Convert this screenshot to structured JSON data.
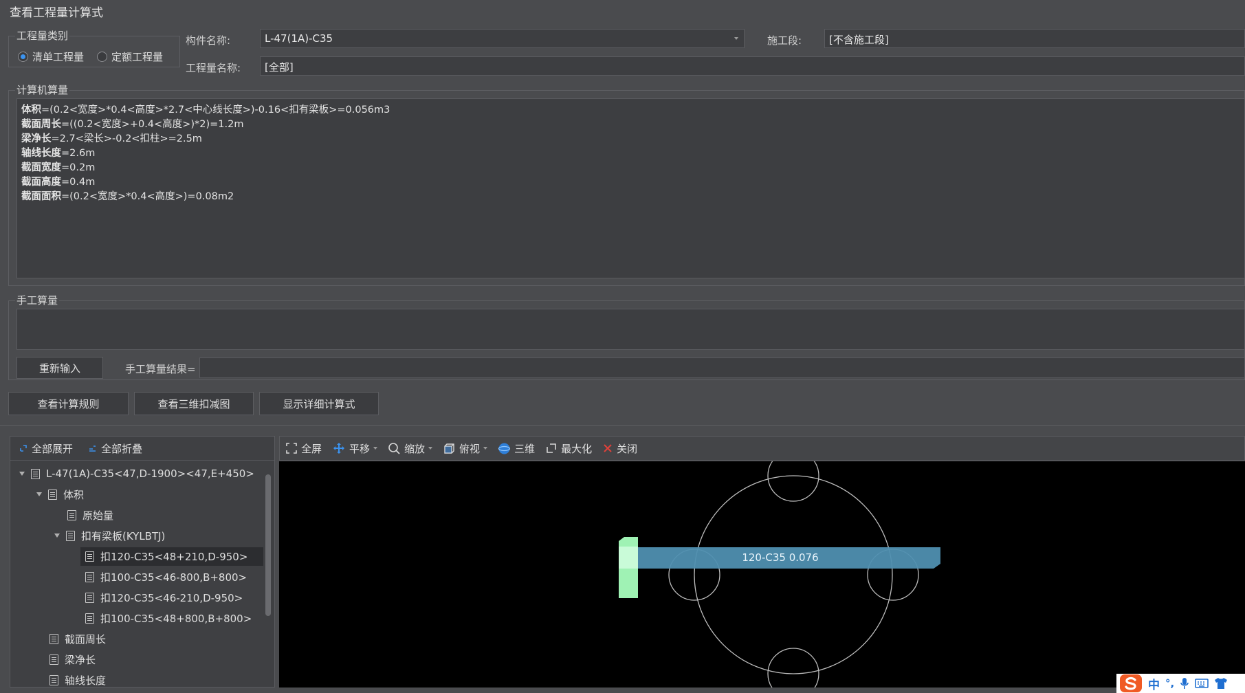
{
  "window": {
    "title": "查看工程量计算式"
  },
  "quantity_type": {
    "legend": "工程量类别",
    "options": [
      {
        "label": "清单工程量",
        "selected": true
      },
      {
        "label": "定额工程量",
        "selected": false
      }
    ]
  },
  "component": {
    "label": "构件名称:",
    "value": "L-47(1A)-C35"
  },
  "stage": {
    "label": "施工段:",
    "value": "[不含施工段]"
  },
  "quantity_name": {
    "label": "工程量名称:",
    "value": "[全部]"
  },
  "computer_calc": {
    "legend": "计算机算量",
    "lines": [
      {
        "name": "体积",
        "expr": "=(0.2<宽度>*0.4<高度>*2.7<中心线长度>)-0.16<扣有梁板>=0.056m3"
      },
      {
        "name": "截面周长",
        "expr": "=((0.2<宽度>+0.4<高度>)*2)=1.2m"
      },
      {
        "name": "梁净长",
        "expr": "=2.7<梁长>-0.2<扣柱>=2.5m"
      },
      {
        "name": "轴线长度",
        "expr": "=2.6m"
      },
      {
        "name": "截面宽度",
        "expr": "=0.2m"
      },
      {
        "name": "截面高度",
        "expr": "=0.4m"
      },
      {
        "name": "截面面积",
        "expr": "=(0.2<宽度>*0.4<高度>)=0.08m2"
      }
    ]
  },
  "manual_calc": {
    "legend": "手工算量",
    "reenter_label": "重新输入",
    "result_label": "手工算量结果="
  },
  "actions": {
    "view_rules": "查看计算规则",
    "view_3d": "查看三维扣减图",
    "show_detail": "显示详细计算式"
  },
  "tree_toolbar": {
    "expand_all": "全部展开",
    "collapse_all": "全部折叠"
  },
  "tree": [
    {
      "label": "L-47(1A)-C35<47,D-1900><47,E+450>",
      "level": 0,
      "expanded": true
    },
    {
      "label": "体积",
      "level": 1,
      "expanded": true
    },
    {
      "label": "原始量",
      "level": 2
    },
    {
      "label": "扣有梁板(KYLBTJ)",
      "level": 2,
      "expanded": true
    },
    {
      "label": "扣120-C35<48+210,D-950>",
      "level": 3,
      "selected": true
    },
    {
      "label": "扣100-C35<46-800,B+800>",
      "level": 3
    },
    {
      "label": "扣120-C35<46-210,D-950>",
      "level": 3
    },
    {
      "label": "扣100-C35<48+800,B+800>",
      "level": 3
    },
    {
      "label": "截面周长",
      "level": 1
    },
    {
      "label": "梁净长",
      "level": 1
    },
    {
      "label": "轴线长度",
      "level": 1
    }
  ],
  "view_toolbar": {
    "fullscreen": "全屏",
    "pan": "平移",
    "zoom": "缩放",
    "top_view": "俯视",
    "three_d": "三维",
    "maximize": "最大化",
    "close": "关闭"
  },
  "canvas": {
    "slab_label": "120-C35 0.076"
  },
  "ime": {
    "lang": "中",
    "punct": "°,"
  },
  "colors": {
    "accent": "#3b93f0",
    "beam": "#4f8fb0",
    "column": "#9ff2b4",
    "close_x": "#e0413a",
    "ime_brand": "#f05a24"
  }
}
